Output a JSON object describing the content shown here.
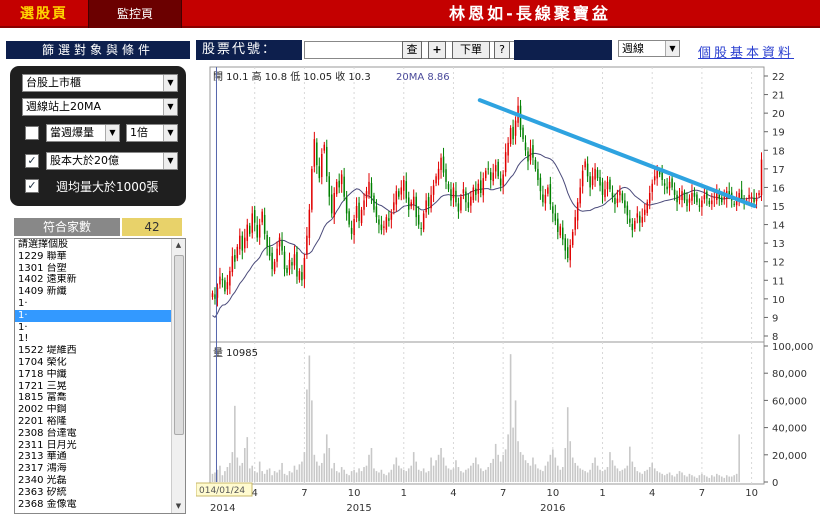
{
  "topbar": {
    "tab_select": "選股頁",
    "tab_monitor": "監控頁",
    "brand": "林恩如-長線聚寶盆"
  },
  "sidebar": {
    "header": "篩選對象與條件",
    "market": "台股上市櫃",
    "ma_condition": "週線站上20MA",
    "vol_checkbox_checked": false,
    "vol_label": "當週爆量",
    "vol_mult": "1倍",
    "cap_checkbox_checked": true,
    "cap_label": "股本大於20億",
    "avg_checkbox_checked": true,
    "avg_label": "週均量大於1000張",
    "count_label": "符合家數",
    "count_value": "42",
    "list": [
      "請選擇個股",
      "1229 聯華",
      "1301 台塑",
      "1402 遠東新",
      "1409 新纖",
      "1·",
      "1·",
      "1·",
      "1!",
      "1522 堤維西",
      "1704 榮化",
      "1718 中纖",
      "1721 三晃",
      "1815 富喬",
      "2002 中鋼",
      "2201 裕隆",
      "2308 台達電",
      "2311 日月光",
      "2313 華通",
      "2317 鴻海",
      "2340 光磊",
      "2363 矽統",
      "2368 金像電"
    ],
    "highlight_index": 6
  },
  "stockbar": {
    "label": "股票代號：",
    "query": "查",
    "plus": "+",
    "next": "下單",
    "help": "?",
    "period": "週線",
    "link": "個股基本資料"
  },
  "chart_data": {
    "type": "candlestick",
    "ohlc_label": "開 10.1  高 10.8  低 10.05  收 10.3",
    "ma_label": "20MA 8.86",
    "vol_label": "量 10985",
    "price_ylim": [
      8,
      22
    ],
    "price_ticks": [
      "22",
      "21",
      "20",
      "19",
      "18",
      "17",
      "16",
      "15",
      "14",
      "13",
      "12",
      "11",
      "10",
      "9",
      "8"
    ],
    "vol_ylim": [
      0,
      100000
    ],
    "vol_ticks": [
      "100,000",
      "80,000",
      "60,000",
      "40,000",
      "20,000",
      "0"
    ],
    "x_ticks": [
      "4",
      "7",
      "10",
      "1",
      "4",
      "7",
      "10",
      "1",
      "4",
      "7",
      "10"
    ],
    "x_years": [
      "2014",
      "2015",
      "2016"
    ],
    "cursor_date": "014/01/24",
    "trendline": {
      "start": [
        0.487,
        20.7
      ],
      "end": [
        0.983,
        15.0
      ]
    },
    "closes": [
      10.3,
      10.0,
      10.6,
      11.2,
      11.0,
      10.4,
      10.9,
      11.5,
      12.3,
      12.0,
      12.8,
      13.4,
      12.6,
      13.3,
      14.0,
      13.5,
      14.6,
      14.1,
      13.3,
      14.0,
      14.7,
      13.5,
      12.8,
      12.3,
      11.6,
      12.0,
      12.7,
      13.3,
      12.6,
      11.6,
      11.4,
      12.1,
      11.8,
      12.4,
      11.2,
      11.5,
      11.0,
      12.2,
      13.4,
      14.8,
      17.0,
      18.6,
      17.2,
      16.5,
      17.8,
      18.3,
      16.6,
      15.5,
      14.6,
      15.7,
      16.3,
      16.0,
      16.7,
      15.5,
      14.6,
      14.0,
      13.5,
      14.3,
      15.0,
      14.2,
      14.8,
      15.3,
      15.8,
      16.3,
      15.5,
      14.8,
      14.4,
      14.0,
      13.7,
      13.9,
      14.4,
      14.2,
      14.6,
      15.2,
      15.8,
      15.5,
      16.0,
      16.4,
      15.4,
      14.8,
      15.2,
      15.5,
      14.4,
      14.0,
      13.8,
      14.6,
      15.3,
      15.0,
      15.6,
      16.1,
      16.6,
      17.0,
      17.6,
      16.8,
      16.3,
      15.9,
      15.3,
      16.0,
      15.2,
      14.7,
      15.5,
      15.9,
      15.2,
      14.9,
      15.5,
      16.0,
      15.6,
      16.2,
      15.7,
      16.5,
      16.9,
      17.0,
      16.4,
      16.8,
      17.2,
      16.6,
      16.1,
      16.7,
      17.9,
      18.4,
      19.2,
      18.6,
      19.6,
      20.4,
      19.1,
      18.6,
      18.0,
      17.4,
      18.1,
      17.6,
      17.0,
      16.4,
      15.8,
      15.2,
      15.6,
      16.0,
      15.1,
      14.6,
      14.2,
      13.6,
      13.9,
      13.2,
      12.6,
      12.2,
      12.9,
      13.6,
      14.4,
      15.2,
      16.0,
      16.9,
      17.4,
      16.6,
      16.0,
      16.6,
      17.0,
      16.5,
      16.1,
      15.6,
      15.9,
      16.3,
      15.9,
      15.5,
      15.1,
      15.4,
      15.8,
      15.3,
      14.9,
      14.5,
      14.1,
      13.7,
      14.2,
      14.6,
      14.1,
      14.4,
      14.8,
      15.2,
      15.7,
      16.2,
      16.6,
      16.9,
      16.7,
      16.4,
      16.1,
      15.9,
      16.3,
      16.0,
      15.6,
      15.2,
      15.5,
      15.8,
      15.3,
      15.0,
      15.4,
      15.7,
      15.5,
      15.2,
      15.0,
      15.3,
      15.6,
      15.4,
      15.1,
      15.3,
      15.5,
      15.7,
      15.4,
      15.2,
      15.5,
      15.8,
      15.6,
      15.3,
      15.1,
      15.4,
      15.7,
      15.4,
      15.2,
      15.3,
      15.6,
      15.5,
      15.2,
      15.4,
      15.7,
      17.5
    ],
    "volumes": [
      6000,
      7000,
      9000,
      12000,
      5000,
      8000,
      11000,
      14000,
      22000,
      56000,
      18000,
      12000,
      14000,
      25000,
      33000,
      10000,
      12000,
      8000,
      7000,
      15000,
      8000,
      6000,
      9000,
      10000,
      5000,
      8000,
      7000,
      9000,
      14000,
      6000,
      5000,
      8000,
      7000,
      12000,
      9000,
      13000,
      15000,
      22000,
      68000,
      93000,
      60000,
      20000,
      15000,
      12000,
      14000,
      21000,
      35000,
      25000,
      10000,
      14000,
      8000,
      7000,
      11000,
      9000,
      6000,
      5000,
      8000,
      9000,
      7000,
      10000,
      8000,
      11000,
      12000,
      20000,
      25000,
      10000,
      8000,
      7000,
      9000,
      6000,
      5000,
      7000,
      9000,
      13000,
      18000,
      12000,
      10000,
      9000,
      8000,
      10000,
      12000,
      22000,
      15000,
      9000,
      8000,
      10000,
      7000,
      8000,
      18000,
      12000,
      16000,
      20000,
      25000,
      18000,
      12000,
      10000,
      9000,
      10000,
      16000,
      11000,
      8000,
      7000,
      9000,
      10000,
      12000,
      14000,
      18000,
      13000,
      10000,
      8000,
      9000,
      11000,
      14000,
      17000,
      28000,
      20000,
      15000,
      20000,
      24000,
      35000,
      94000,
      40000,
      60000,
      30000,
      22000,
      20000,
      16000,
      14000,
      12000,
      18000,
      13000,
      10000,
      9000,
      8000,
      12000,
      15000,
      20000,
      24000,
      18000,
      12000,
      9000,
      11000,
      25000,
      55000,
      30000,
      18000,
      14000,
      12000,
      10000,
      9000,
      8000,
      7000,
      9000,
      14000,
      18000,
      12000,
      9000,
      8000,
      9000,
      11000,
      22000,
      16000,
      12000,
      10000,
      8000,
      9000,
      10000,
      12000,
      26000,
      15000,
      11000,
      8000,
      7000,
      6000,
      8000,
      9000,
      11000,
      14000,
      10000,
      8000,
      7000,
      6000,
      5000,
      6000,
      7000,
      5000,
      4000,
      6000,
      8000,
      7000,
      5000,
      4000,
      6000,
      5000,
      4000,
      3000,
      5000,
      6000,
      5000,
      4000,
      3000,
      5000,
      4000,
      6000,
      5000,
      4000,
      3000,
      5000,
      4000,
      4000,
      5000,
      6000,
      35000
    ]
  }
}
